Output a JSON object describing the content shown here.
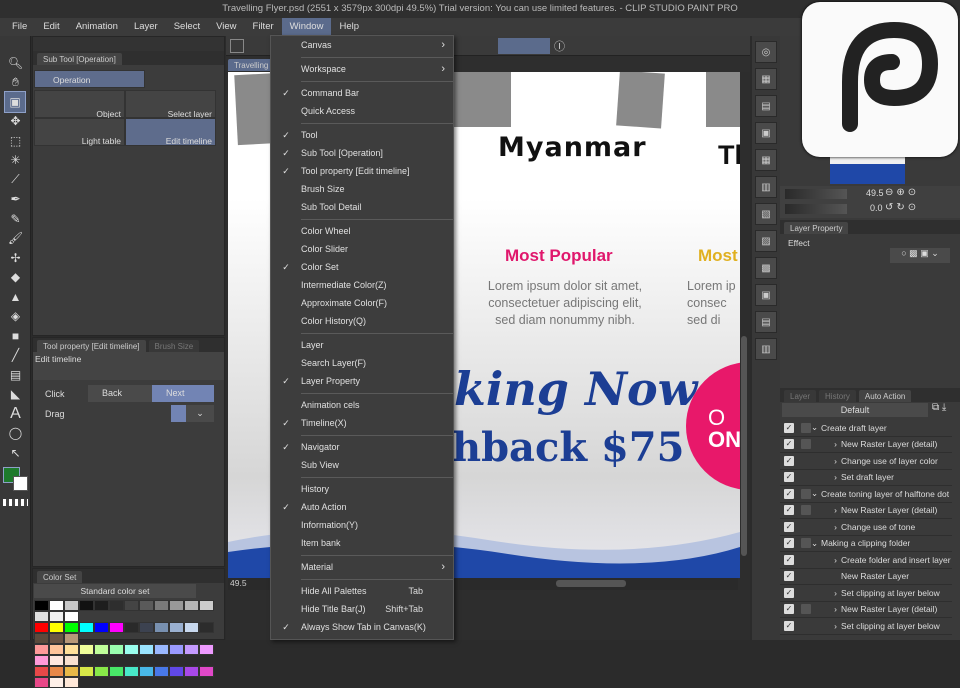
{
  "title": "Travelling Flyer.psd (2551 x 3579px 300dpi 49.5%)  Trial version: You can use limited features. - CLIP STUDIO PAINT PRO",
  "menu": [
    "File",
    "Edit",
    "Animation",
    "Layer",
    "Select",
    "View",
    "Filter",
    "Window",
    "Help"
  ],
  "active_menu": "Window",
  "sub_tool": {
    "tab": "Sub Tool [Operation]",
    "group": "Operation",
    "items": [
      "Object",
      "Select layer",
      "Light table",
      "Edit timeline"
    ],
    "selected": "Edit timeline"
  },
  "tool_property": {
    "tab": "Tool property [Edit timeline]",
    "tab2": "Brush Size",
    "title": "Edit timeline",
    "click_label": "Click",
    "back": "Back",
    "next": "Next",
    "drag_label": "Drag"
  },
  "color_set": {
    "tab": "Color Set",
    "selected_set": "Standard color set",
    "rows": [
      [
        "#000000",
        "#ffffff",
        "#c8c8c8",
        "#111111",
        "#1e1e1e",
        "#2e2e2e",
        "#444444",
        "#5a5a5a",
        "#7a7a7a",
        "#999999",
        "#b4b4b4",
        "#cccccc",
        "#e0e0e0",
        "#f0f0f0",
        "#ffffff"
      ],
      [
        "#ff0000",
        "#ffff00",
        "#00ff00",
        "#00ffff",
        "#0000ff",
        "#ff00ff",
        "#2a2a2a",
        "#3c4250",
        "#7890b0",
        "#9ab0d0",
        "#c8d8ee",
        "#2c2c2c",
        "#5a4a3c",
        "#6a5444",
        "#b89878"
      ],
      [
        "#ff9a9a",
        "#ffc49a",
        "#ffe09a",
        "#f0ff9a",
        "#c0ff9a",
        "#9affb0",
        "#9affee",
        "#9ae4ff",
        "#9ab8ff",
        "#9a9aff",
        "#c49aff",
        "#ee9aff",
        "#ff9ad8",
        "#ffe8e0",
        "#f8e0d0"
      ],
      [
        "#e84848",
        "#e88848",
        "#e8b848",
        "#d8e848",
        "#88e848",
        "#48e868",
        "#48e8c8",
        "#48b8e8",
        "#4878e8",
        "#6048e8",
        "#a848e8",
        "#e048c8",
        "#e84888",
        "#fff0e8",
        "#ffe8d8"
      ]
    ]
  },
  "colors": {
    "main": "#1e7a2c",
    "sub": "#ffffff",
    "accent": "#5b6b8c"
  },
  "canvas": {
    "tab": "Travelling F",
    "zoom": "49.5",
    "flyer": {
      "heading1": "Myanmar",
      "heading2": "Th",
      "sub1": "Most Popular",
      "sub2": "Most",
      "body1": [
        "Lorem ipsum dolor sit amet,",
        "consectetuer adipiscing elit,",
        "sed diam nonummy nibh."
      ],
      "body2": [
        "Lorem ip",
        "consec",
        "sed di"
      ],
      "cta1": "king Now",
      "cta2": "hback $75",
      "badge1": "O",
      "badge2": "ON"
    }
  },
  "window_menu": [
    {
      "label": "Canvas",
      "submenu": true
    },
    {
      "sep": true
    },
    {
      "label": "Workspace",
      "submenu": true
    },
    {
      "sep": true
    },
    {
      "label": "Command Bar",
      "checked": true
    },
    {
      "label": "Quick Access"
    },
    {
      "sep": true
    },
    {
      "label": "Tool",
      "checked": true
    },
    {
      "label": "Sub Tool [Operation]",
      "checked": true
    },
    {
      "label": "Tool property [Edit timeline]",
      "checked": true
    },
    {
      "label": "Brush Size"
    },
    {
      "label": "Sub Tool Detail"
    },
    {
      "sep": true
    },
    {
      "label": "Color Wheel"
    },
    {
      "label": "Color Slider"
    },
    {
      "label": "Color Set",
      "checked": true
    },
    {
      "label": "Intermediate Color(Z)"
    },
    {
      "label": "Approximate Color(F)"
    },
    {
      "label": "Color History(Q)"
    },
    {
      "sep": true
    },
    {
      "label": "Layer"
    },
    {
      "label": "Search Layer(F)"
    },
    {
      "label": "Layer Property",
      "checked": true
    },
    {
      "sep": true
    },
    {
      "label": "Animation cels"
    },
    {
      "label": "Timeline(X)",
      "checked": true
    },
    {
      "sep": true
    },
    {
      "label": "Navigator",
      "checked": true
    },
    {
      "label": "Sub View"
    },
    {
      "sep": true
    },
    {
      "label": "History"
    },
    {
      "label": "Auto Action",
      "checked": true
    },
    {
      "label": "Information(Y)"
    },
    {
      "label": "Item bank"
    },
    {
      "sep": true
    },
    {
      "label": "Material",
      "submenu": true
    },
    {
      "sep": true
    },
    {
      "label": "Hide All Palettes",
      "shortcut": "Tab"
    },
    {
      "label": "Hide Title Bar(J)",
      "shortcut": "Shift+Tab"
    },
    {
      "label": "Always Show Tab in Canvas(K)",
      "checked": true
    }
  ],
  "navigator": {
    "zoom": "49.5",
    "rotation": "0.0"
  },
  "layer_property": {
    "tab": "Layer Property",
    "effect": "Effect"
  },
  "auto_action": {
    "tabs": [
      "Layer",
      "History",
      "Auto Action"
    ],
    "set": "Default",
    "items": [
      {
        "label": "Create draft layer",
        "level": 0,
        "box": true,
        "expanded": true
      },
      {
        "label": "New Raster Layer (detail)",
        "level": 1,
        "box": true,
        "chev": true
      },
      {
        "label": "Change use of layer color",
        "level": 1,
        "chev": true
      },
      {
        "label": "Set draft layer",
        "level": 1,
        "chev": true
      },
      {
        "label": "Create toning layer of halftone dot",
        "level": 0,
        "box": true,
        "expanded": true
      },
      {
        "label": "New Raster Layer (detail)",
        "level": 1,
        "box": true,
        "chev": true
      },
      {
        "label": "Change use of tone",
        "level": 1,
        "chev": true
      },
      {
        "label": "Making a clipping folder",
        "level": 0,
        "box": true,
        "expanded": true
      },
      {
        "label": "Create folder and insert layer",
        "level": 1,
        "chev": true
      },
      {
        "label": "New Raster Layer",
        "level": 1
      },
      {
        "label": "Set clipping at layer below",
        "level": 1,
        "chev": true
      },
      {
        "label": "New Raster Layer (detail)",
        "level": 1,
        "box": true,
        "chev": true
      },
      {
        "label": "Set clipping at layer below",
        "level": 1,
        "chev": true
      }
    ]
  }
}
